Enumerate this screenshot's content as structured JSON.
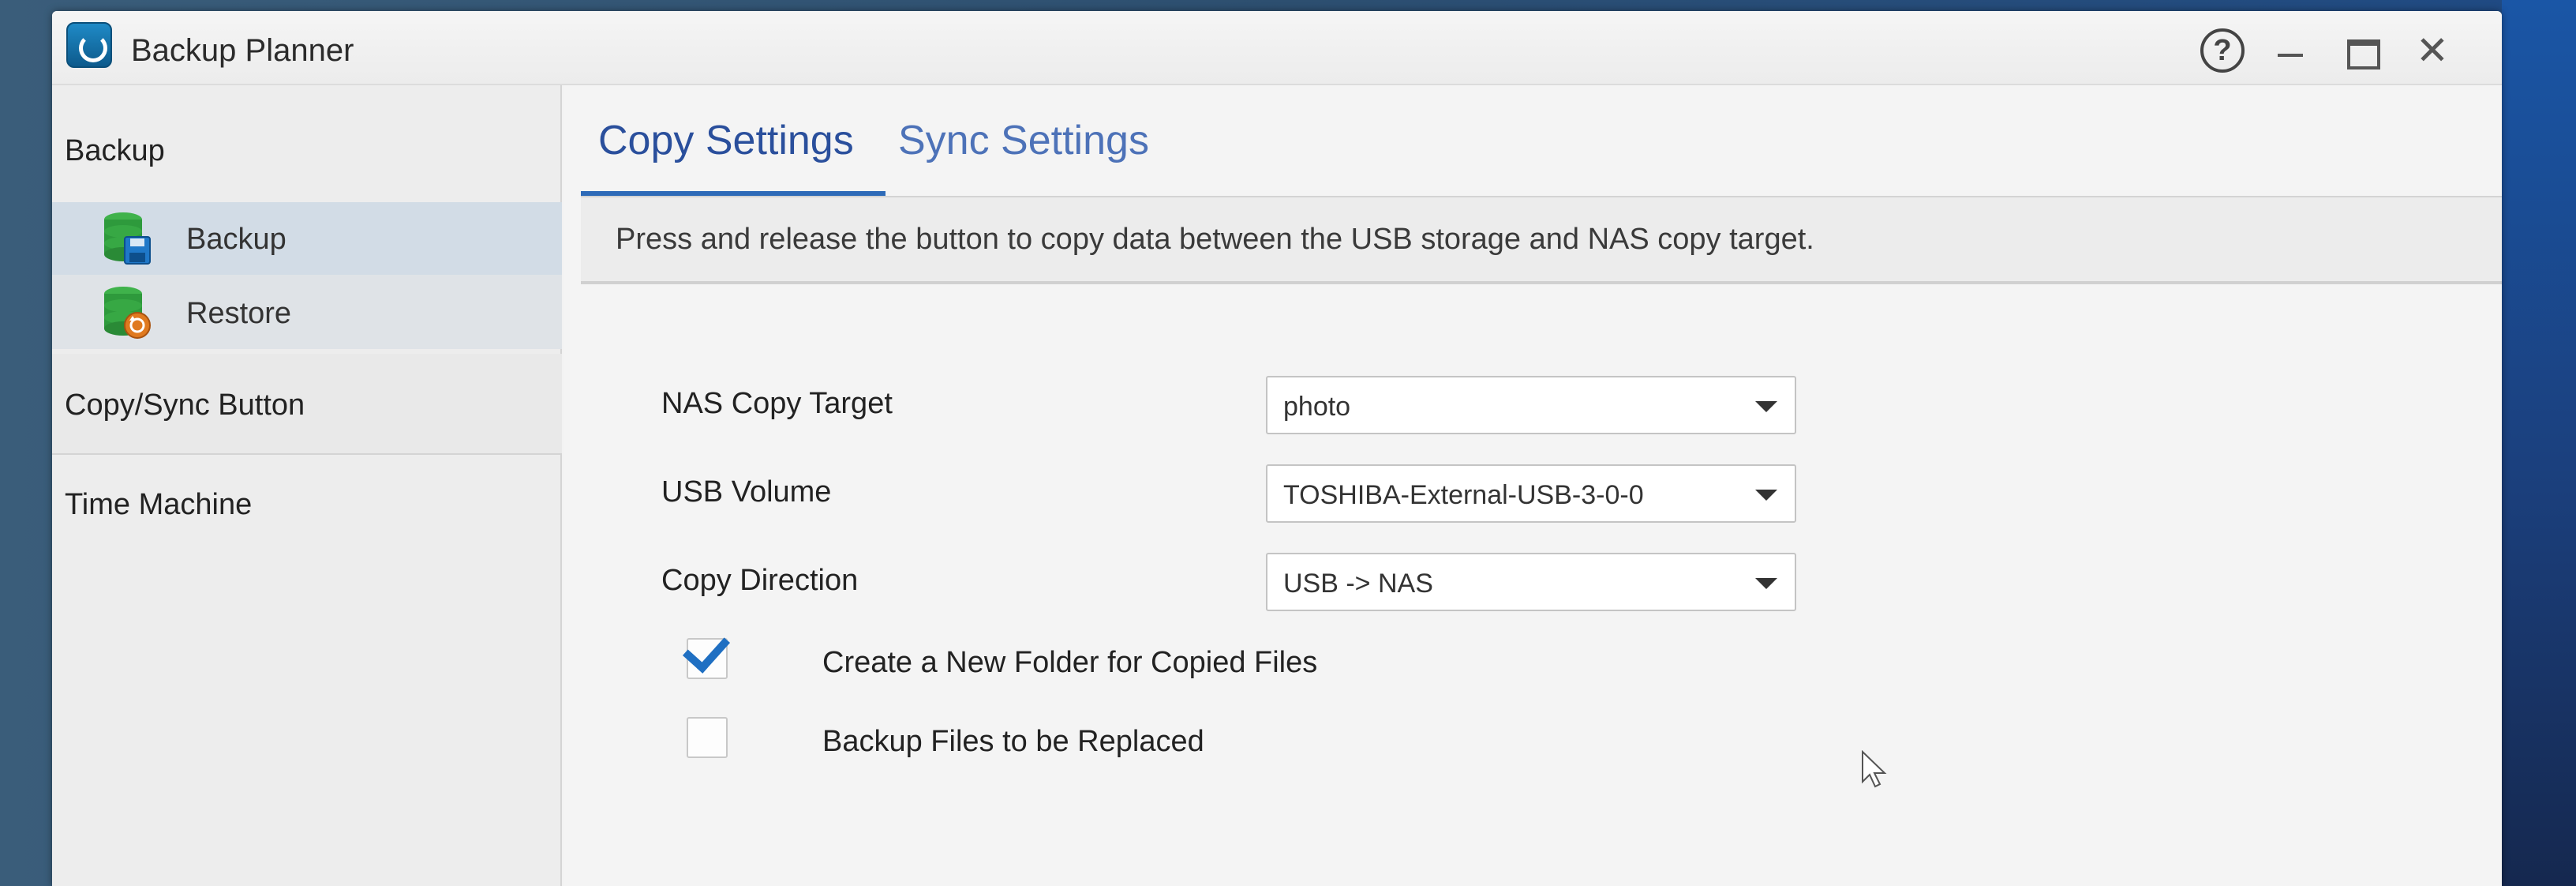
{
  "window": {
    "title": "Backup Planner",
    "controls": {
      "help": "?",
      "close": "✕"
    }
  },
  "sidebar": {
    "backup_section": "Backup",
    "items": [
      {
        "label": "Backup",
        "icon": "database-save-icon",
        "selected": true
      },
      {
        "label": "Restore",
        "icon": "database-restore-icon",
        "selected": false
      }
    ],
    "copy_sync_button": "Copy/Sync Button",
    "time_machine": "Time Machine"
  },
  "tabs": [
    {
      "label": "Copy Settings",
      "active": true
    },
    {
      "label": "Sync Settings",
      "active": false
    }
  ],
  "info": "Press and release the button to copy data between the USB storage and NAS copy target.",
  "form": {
    "nas_copy_target": {
      "label": "NAS Copy Target",
      "value": "photo"
    },
    "usb_volume": {
      "label": "USB Volume",
      "value": "TOSHIBA-External-USB-3-0-0"
    },
    "copy_direction": {
      "label": "Copy Direction",
      "value": "USB -> NAS"
    },
    "create_new_folder": {
      "label": "Create a New Folder for Copied Files",
      "checked": true
    },
    "backup_replaced": {
      "label": "Backup Files to be Replaced",
      "checked": false
    }
  },
  "colors": {
    "accent": "#2e6bb8",
    "tab_active": "#2a4f9c",
    "checkbox": "#1f6fc2",
    "icon_green": "#2e9a3c",
    "icon_blue": "#1f78c8",
    "icon_orange": "#e07a1f"
  }
}
